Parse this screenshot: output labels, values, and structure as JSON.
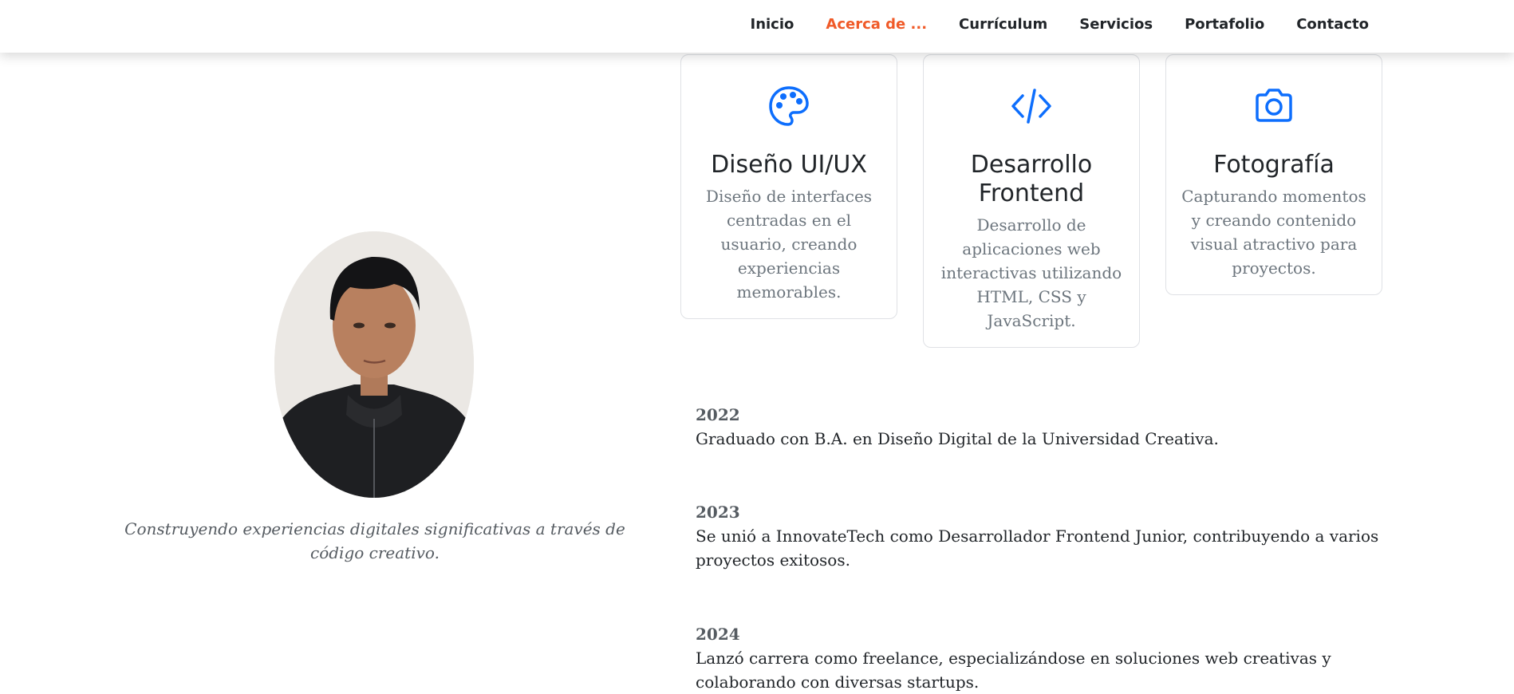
{
  "nav": {
    "items": [
      {
        "label": "Inicio"
      },
      {
        "label": "Acerca de ..."
      },
      {
        "label": "Currículum"
      },
      {
        "label": "Servicios"
      },
      {
        "label": "Portafolio"
      },
      {
        "label": "Contacto"
      }
    ],
    "active_index": 1
  },
  "colors": {
    "accent": "#f05a28",
    "icon": "#0d6efd",
    "muted": "#6c757d",
    "text": "#212529"
  },
  "services": [
    {
      "icon": "palette-icon",
      "title": "Diseño UI/UX",
      "text": "Diseño de interfaces centradas en el usuario, creando experiencias memorables."
    },
    {
      "icon": "code-icon",
      "title": "Desarrollo Frontend",
      "text": "Desarrollo de aplicaciones web interactivas utilizando HTML, CSS y JavaScript."
    },
    {
      "icon": "camera-icon",
      "title": "Fotografía",
      "text": "Capturando momentos y creando contenido visual atractivo para proyectos."
    }
  ],
  "profile": {
    "tagline": "Construyendo experiencias digitales significativas a través de código creativo."
  },
  "timeline": [
    {
      "year": "2022",
      "text": "Graduado con B.A. en Diseño Digital de la Universidad Creativa."
    },
    {
      "year": "2023",
      "text": "Se unió a InnovateTech como Desarrollador Frontend Junior, contribuyendo a varios proyectos exitosos."
    },
    {
      "year": "2024",
      "text": "Lanzó carrera como freelance, especializándose en soluciones web creativas y colaborando con diversas startups."
    }
  ]
}
